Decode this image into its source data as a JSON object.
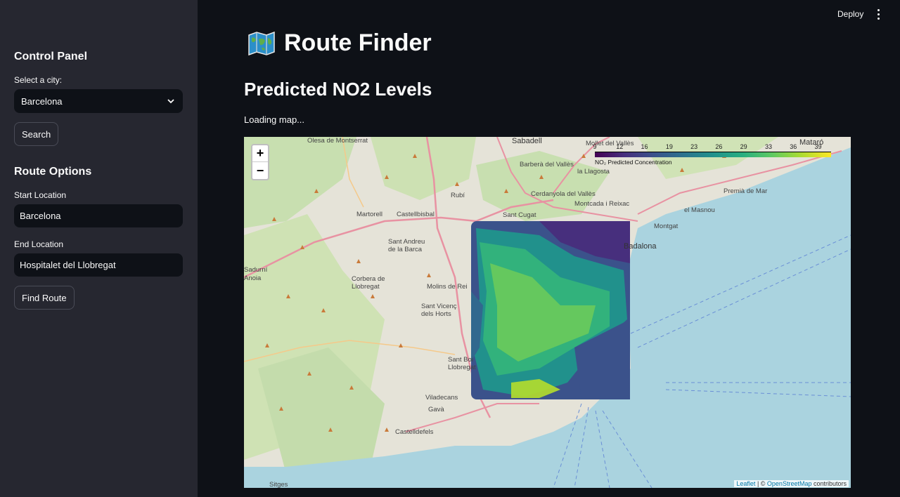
{
  "header": {
    "deploy_label": "Deploy",
    "menu_icon": "kebab-menu-icon"
  },
  "sidebar": {
    "heading": "Control Panel",
    "city_label": "Select a city:",
    "city_value": "Barcelona",
    "search_label": "Search",
    "route_heading": "Route Options",
    "start_label": "Start Location",
    "start_value": "Barcelona",
    "end_label": "End Location",
    "end_value": "Hospitalet del Llobregat",
    "find_route_label": "Find Route"
  },
  "main": {
    "title": "Route Finder",
    "title_icon": "world-map-icon",
    "subtitle": "Predicted NO2 Levels",
    "loading_text": "Loading map..."
  },
  "map": {
    "zoom_in": "+",
    "zoom_out": "−",
    "legend": {
      "ticks": [
        "9",
        "12",
        "16",
        "19",
        "23",
        "26",
        "29",
        "33",
        "36",
        "39"
      ],
      "caption": "NO₂ Predicted Concentration"
    },
    "attribution": {
      "leaflet": "Leaflet",
      "sep": " | © ",
      "osm": "OpenStreetMap",
      "suffix": " contributors"
    },
    "places": [
      "Sabadell",
      "Olesa de Montserrat",
      "Barberà del Vallès",
      "Mollet del Vallès",
      "la Llagosta",
      "Mataró",
      "Rubí",
      "Cerdanyola del Vallès",
      "Montcada i Reixac",
      "Premià de Mar",
      "Sant Cugat",
      "Martorell",
      "Castellbisbal",
      "el Masnou",
      "Montgat",
      "Sant Andreu de la Barca",
      "Badalona",
      "Sadurní",
      "Anoia",
      "Corbera de Llobregat",
      "Molins de Rei",
      "Sant Vicenç dels Horts",
      "Sant Boi Llobregat",
      "Viladecans",
      "Gavà",
      "Castelldefels",
      "Sitges"
    ]
  },
  "colors": {
    "accent": "#ff4b4b",
    "sidebar_bg": "#262730",
    "app_bg": "#0e1117",
    "sea": "#aad3df"
  }
}
